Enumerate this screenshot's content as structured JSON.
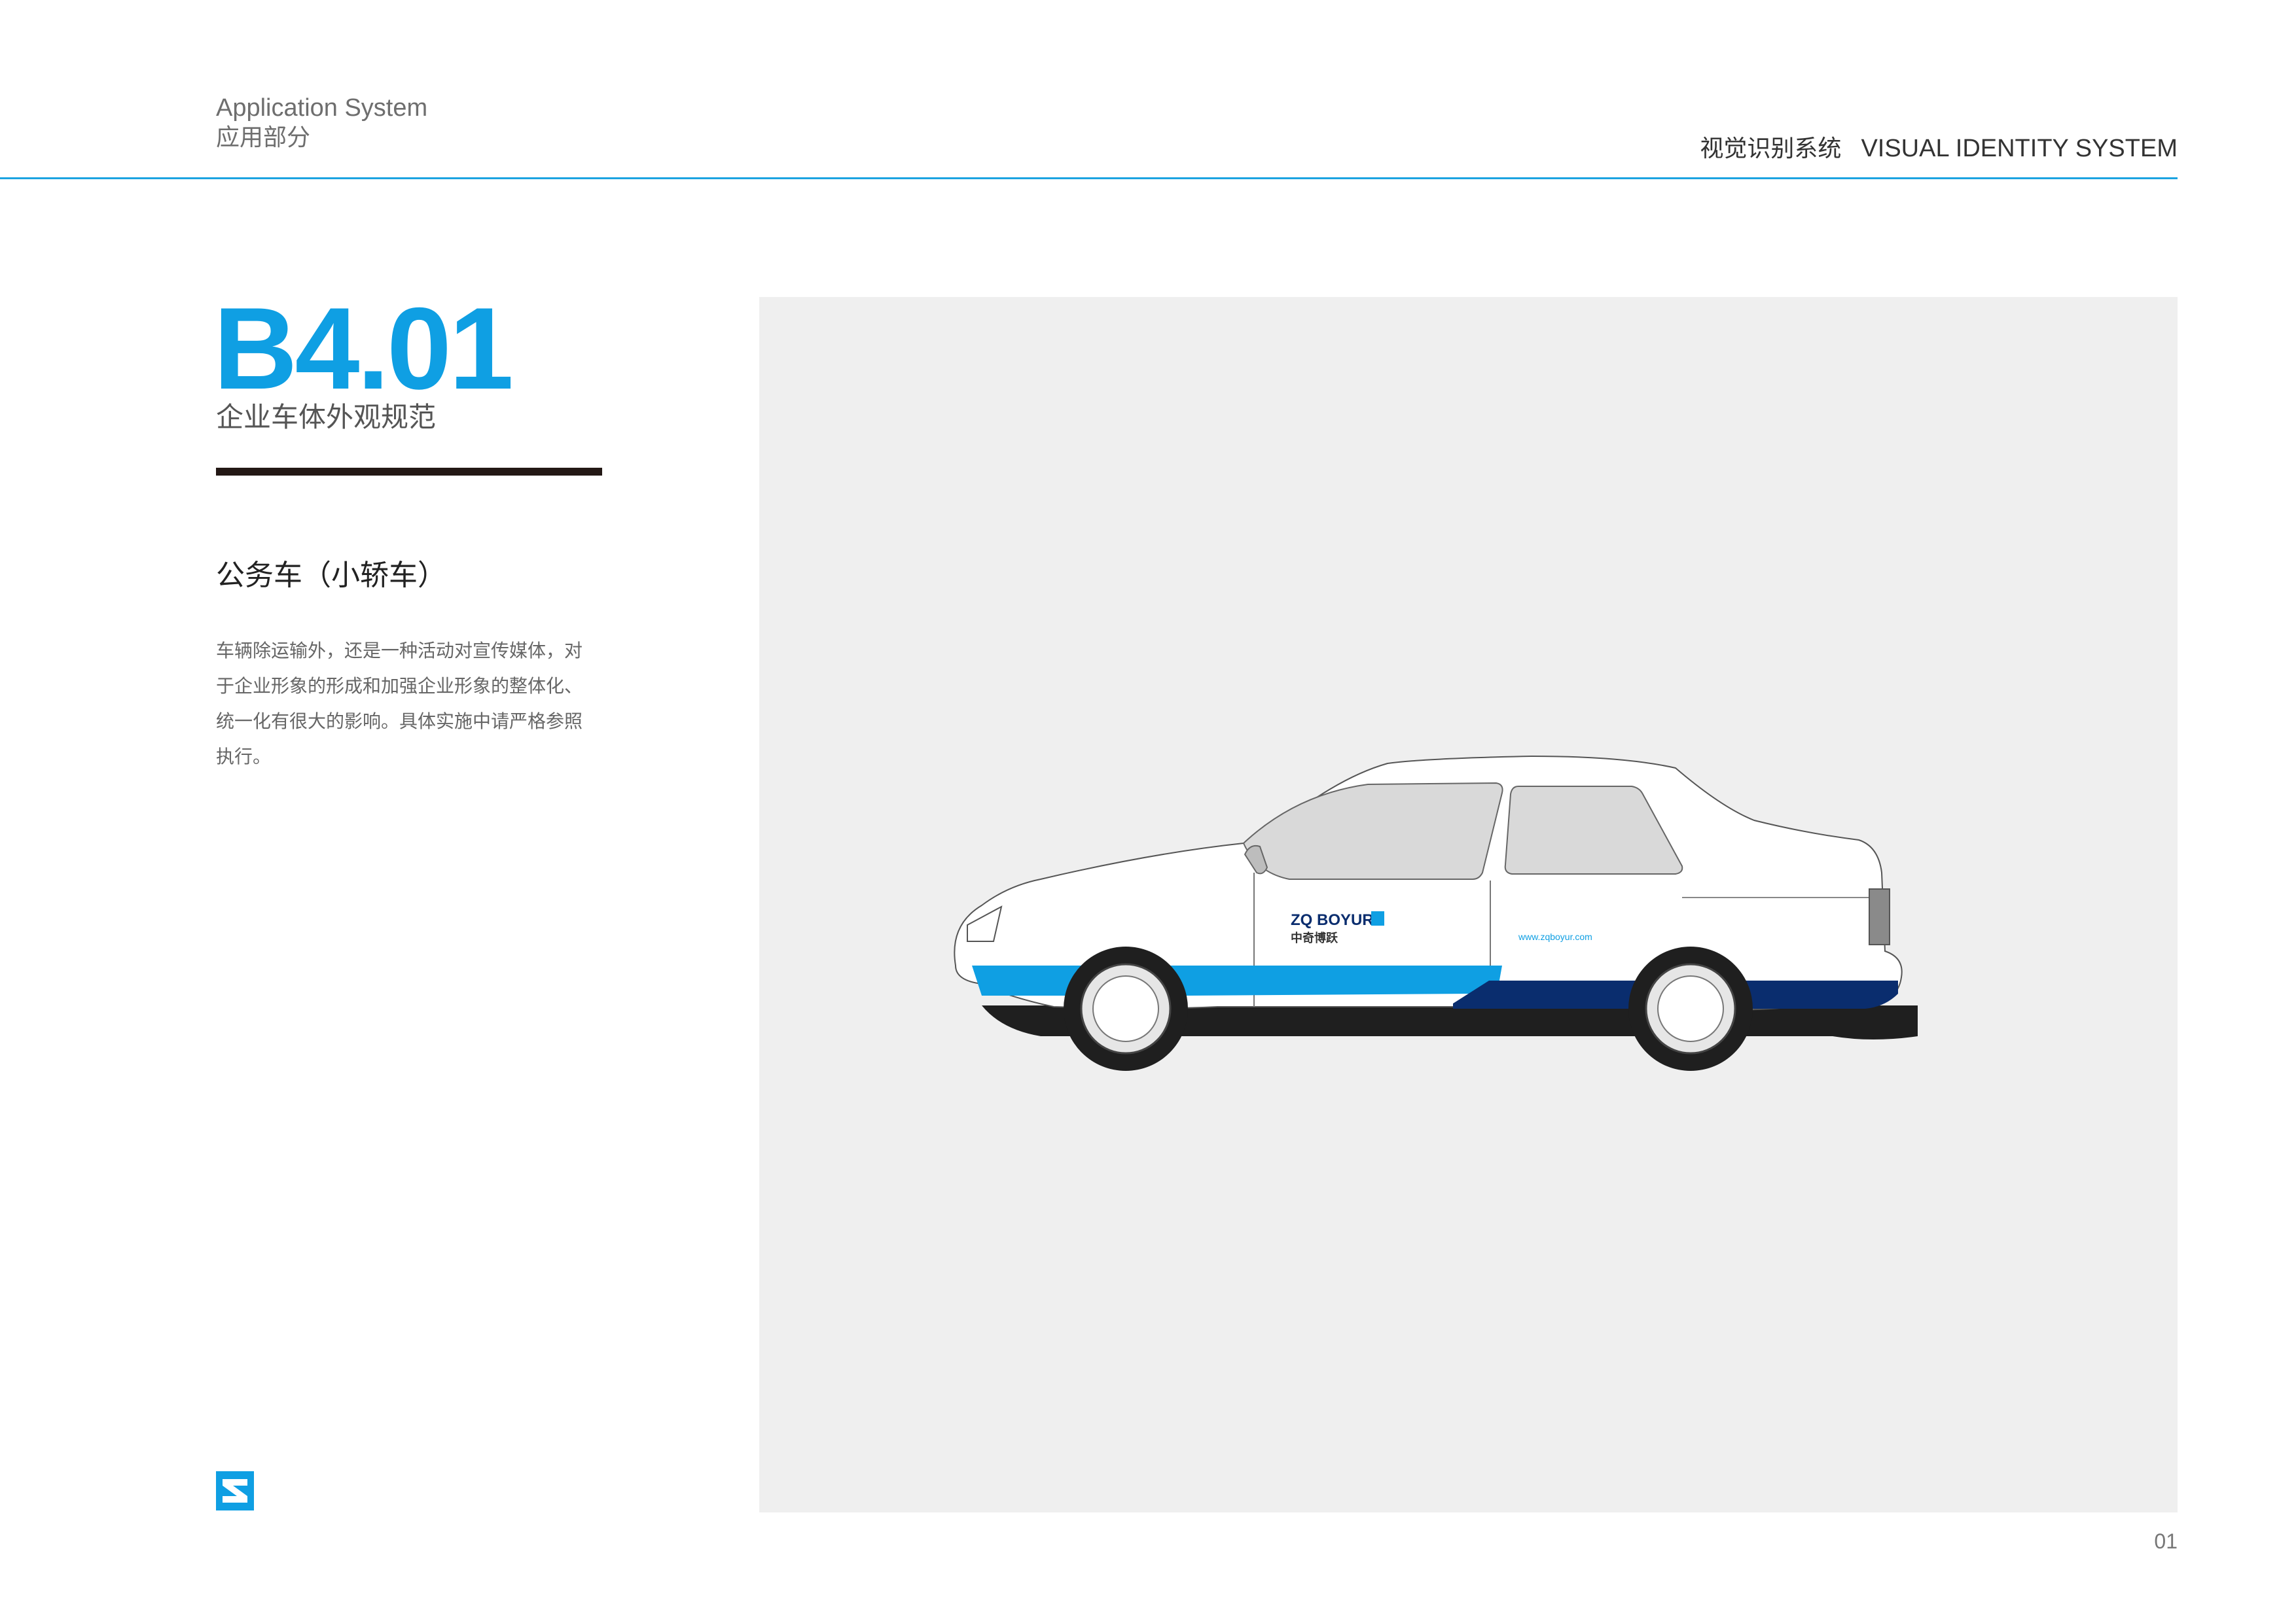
{
  "header": {
    "section_en": "Application System",
    "section_cn": "应用部分",
    "system_cn": "视觉识别系统",
    "system_en": "VISUAL IDENTITY SYSTEM"
  },
  "content": {
    "code": "B4.01",
    "code_subtitle": "企业车体外观规范",
    "item_title": "公务车（小轿车）",
    "description": "车辆除运输外，还是一种活动对宣传媒体，对\n于企业形象的形成和加强企业形象的整体化、\n统一化有很大的影响。具体实施中请严格参照\n执行。"
  },
  "car": {
    "brand_name": "ZQ BOYUR",
    "brand_cn": "中奇博跃",
    "website": "www.zqboyur.com"
  },
  "footer": {
    "page_number": "01"
  },
  "colors": {
    "brand_blue": "#0f9fe3",
    "navy": "#0a2d6e",
    "panel": "#efefef",
    "rule": "#231815"
  }
}
